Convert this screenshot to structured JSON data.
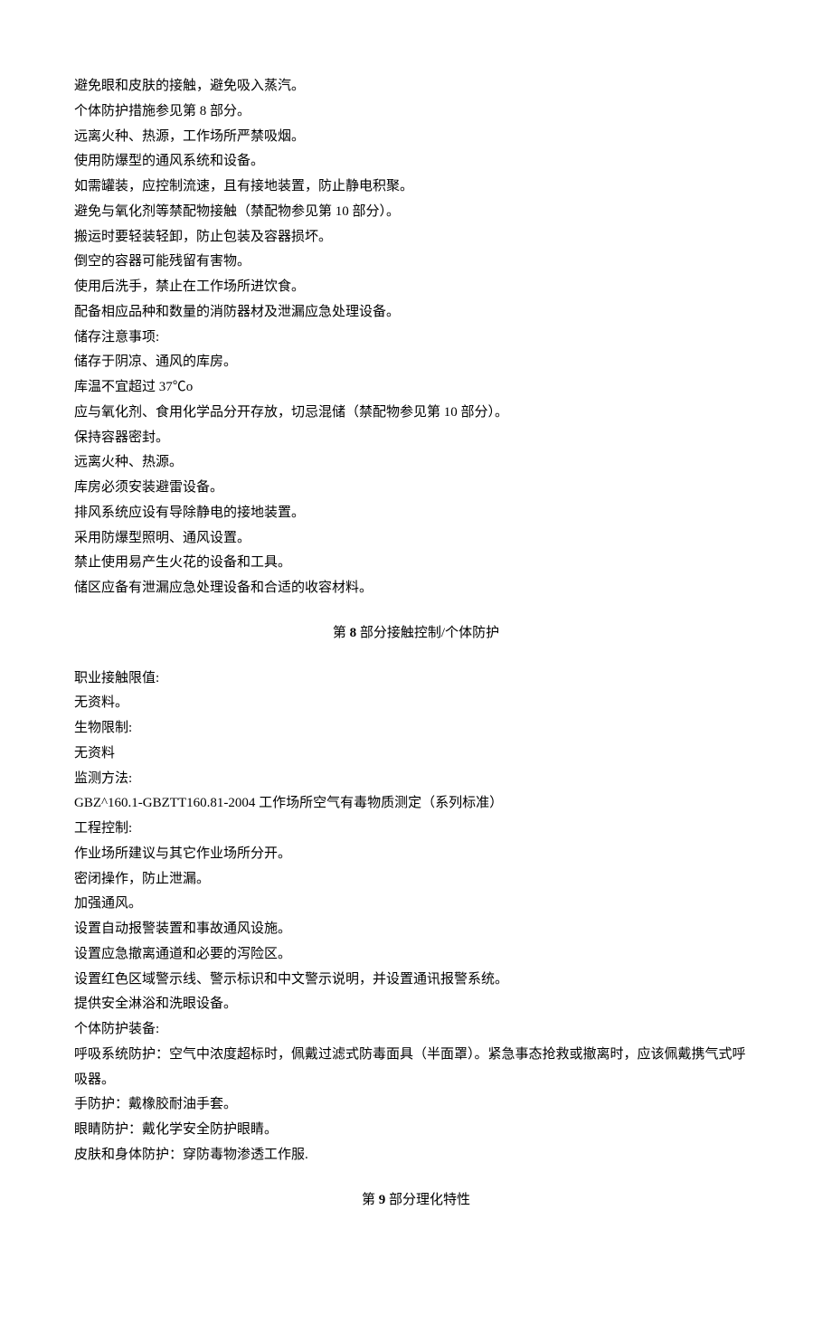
{
  "section7_cont": [
    "避免眼和皮肤的接触，避免吸入蒸汽。",
    "个体防护措施参见第 8 部分。",
    "远离火种、热源，工作场所严禁吸烟。",
    "使用防爆型的通风系统和设备。",
    "如需罐装，应控制流速，且有接地装置，防止静电积聚。",
    "避免与氧化剂等禁配物接触（禁配物参见第 10 部分）。",
    "搬运时要轻装轻卸，防止包装及容器损坏。",
    "倒空的容器可能残留有害物。",
    "使用后洗手，禁止在工作场所进饮食。",
    "配备相应品种和数量的消防器材及泄漏应急处理设备。",
    "储存注意事项:",
    "储存于阴凉、通风的库房。",
    "库温不宜超过 37℃o",
    "应与氧化剂、食用化学品分开存放，切忌混储（禁配物参见第 10 部分）。",
    "保持容器密封。",
    "远离火种、热源。",
    "库房必须安装避雷设备。",
    "排风系统应设有导除静电的接地装置。",
    "采用防爆型照明、通风设置。",
    "禁止使用易产生火花的设备和工具。",
    "储区应备有泄漏应急处理设备和合适的收容材料。"
  ],
  "heading8": {
    "prefix": "第",
    "num": "8",
    "suffix": "部分接触控制/个体防护"
  },
  "section8": [
    "职业接触限值:",
    "无资料。",
    "生物限制:",
    "无资料",
    "监测方法:",
    "GBZ^160.1-GBZTT160.81-2004 工作场所空气有毒物质测定（系列标准）",
    "工程控制:",
    "作业场所建议与其它作业场所分开。",
    "密闭操作，防止泄漏。",
    "加强通风。",
    "设置自动报警装置和事故通风设施。",
    "设置应急撤离通道和必要的泻险区。",
    "设置红色区域警示线、警示标识和中文警示说明，并设置通讯报警系统。",
    "提供安全淋浴和洗眼设备。",
    "个体防护装备:",
    "呼吸系统防护：空气中浓度超标时，佩戴过滤式防毒面具（半面罩）。紧急事态抢救或撤离时，应该佩戴携气式呼吸器。",
    "手防护：戴橡胶耐油手套。",
    "眼睛防护：戴化学安全防护眼睛。",
    "皮肤和身体防护：穿防毒物渗透工作服."
  ],
  "heading9": {
    "prefix": "第",
    "num": "9",
    "suffix": "部分理化特性"
  }
}
